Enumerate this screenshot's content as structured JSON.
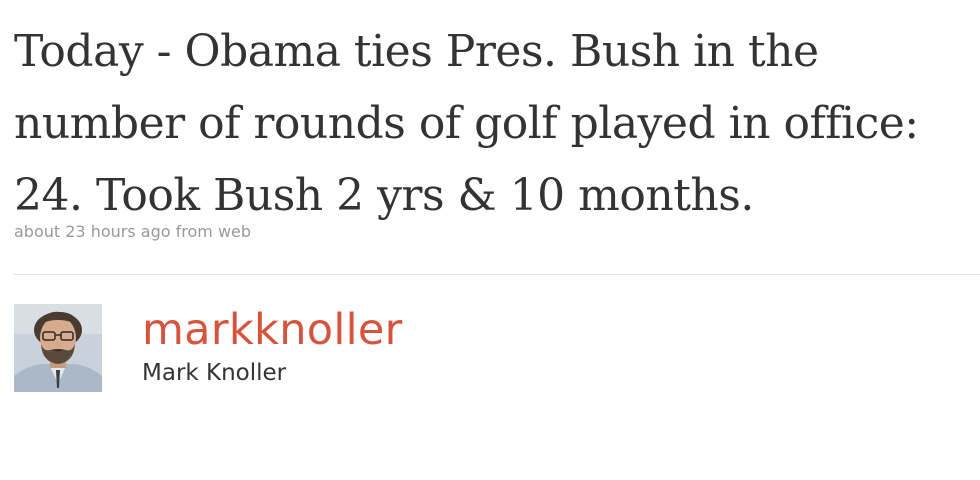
{
  "tweet": {
    "text": "Today - Obama ties Pres. Bush in the number of rounds of golf played in office: 24. Took Bush 2 yrs & 10 months.",
    "timestamp": "about 23 hours ago",
    "source_prefix": "from",
    "source": "web"
  },
  "author": {
    "screen_name": "markknoller",
    "full_name": "Mark Knoller",
    "avatar_icon": "user-avatar-photo"
  },
  "colors": {
    "screen_name": "#d6543c",
    "text": "#333333",
    "meta": "#999999"
  }
}
